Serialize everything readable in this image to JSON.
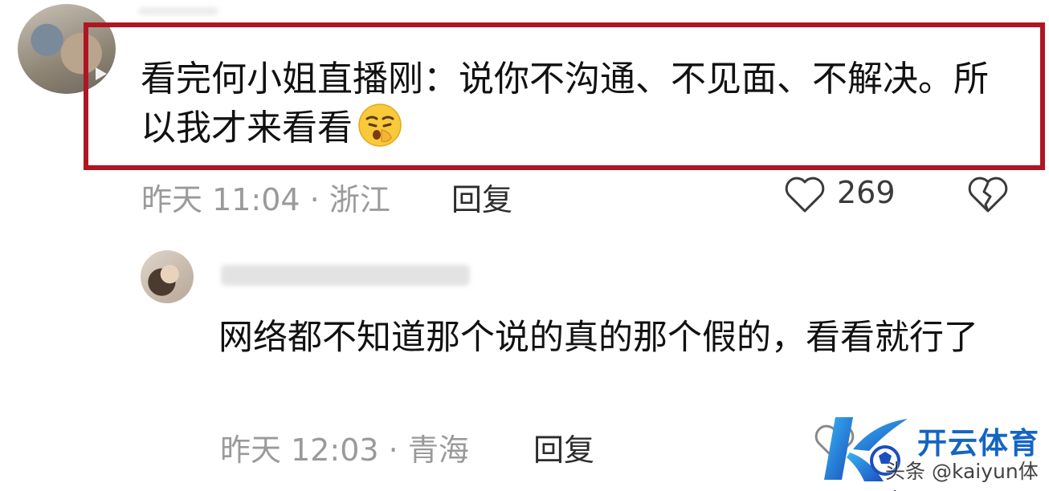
{
  "comments": [
    {
      "text": "看完何小姐直播刚：说你不沟通、不见面、不解决。所以我才来看看",
      "emoji": "shush-face-emoji",
      "meta": "昨天 11:04 · 浙江",
      "reply_label": "回复",
      "like_count": "269",
      "highlighted": true
    },
    {
      "text": "网络都不知道那个说的真的那个假的，看看就行了",
      "meta": "昨天 12:03 · 青海",
      "reply_label": "回复"
    }
  ],
  "watermark": {
    "title": "开云体育",
    "subtitle": "头条 @kaiyun体育"
  },
  "colors": {
    "highlight_border": "#b01524",
    "meta_text": "#9a9a9a",
    "watermark_blue": "#1565c0"
  }
}
